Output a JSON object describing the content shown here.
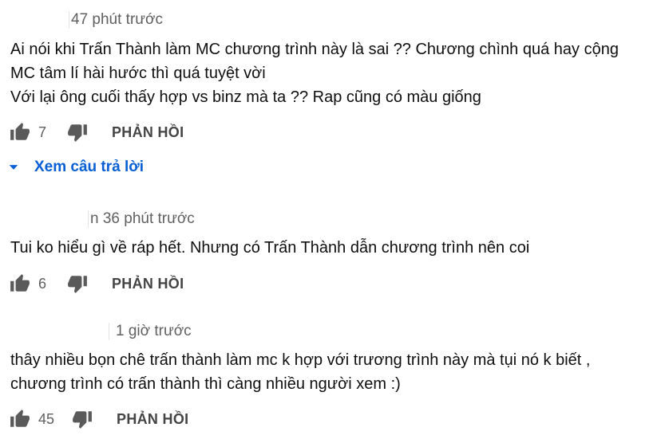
{
  "comments": [
    {
      "timestamp": "47 phút trước",
      "text": "Ai nói khi Trấn Thành làm MC chương trình này là sai ?? Chương chình quá hay cộng\nMC tâm lí hài hước thì quá tuyệt vời\nVới lại ông cuối thấy hợp vs binz mà ta ?? Rap cũng có màu giống",
      "likes": "7",
      "reply_label": "PHẢN HỒI",
      "view_replies_label": "Xem câu trả lời"
    },
    {
      "timestamp": "n 36 phút trước",
      "text": "Tui ko hiểu gì về ráp hết. Nhưng có Trấn Thành dẫn chương trình nên coi",
      "likes": "6",
      "reply_label": "PHẢN HỒI"
    },
    {
      "timestamp": "1 giờ trước",
      "text": "thây nhiều bọn chê trấn thành làm mc k hợp với trương trình này mà tụi nó k biết ,\nchương trình có trấn thành thì càng nhiều người xem :)",
      "likes": "45",
      "reply_label": "PHẢN HỒI"
    }
  ],
  "icons": {
    "like": "thumb-up-icon",
    "dislike": "thumb-down-icon",
    "expand": "caret-down-icon"
  },
  "colors": {
    "text": "#0f0f0f",
    "secondary": "#606060",
    "link": "#065fd4"
  }
}
